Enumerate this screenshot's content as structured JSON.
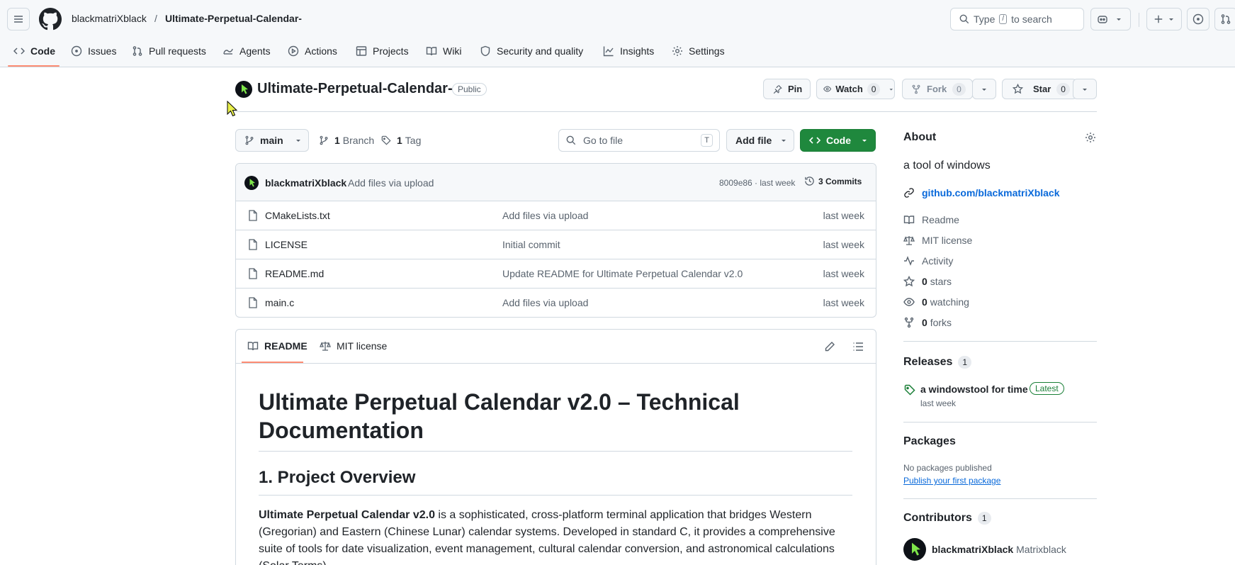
{
  "header": {
    "owner": "blackmatriXblack",
    "separator": "/",
    "repo": "Ultimate-Perpetual-Calendar-",
    "search_placeholder": "Type",
    "search_key": "/",
    "search_suffix": "to search"
  },
  "nav": {
    "tabs": [
      {
        "label": "Code",
        "icon": "code-icon"
      },
      {
        "label": "Issues",
        "icon": "issue-icon"
      },
      {
        "label": "Pull requests",
        "icon": "pull-request-icon"
      },
      {
        "label": "Agents",
        "icon": "agent-icon"
      },
      {
        "label": "Actions",
        "icon": "play-icon"
      },
      {
        "label": "Projects",
        "icon": "table-icon"
      },
      {
        "label": "Wiki",
        "icon": "book-icon"
      },
      {
        "label": "Security and quality",
        "icon": "shield-icon"
      },
      {
        "label": "Insights",
        "icon": "graph-icon"
      },
      {
        "label": "Settings",
        "icon": "gear-icon"
      }
    ]
  },
  "repo": {
    "title": "Ultimate-Perpetual-Calendar-",
    "visibility": "Public",
    "pin_label": "Pin",
    "watch_label": "Watch",
    "watch_count": "0",
    "fork_label": "Fork",
    "fork_count": "0",
    "star_label": "Star",
    "star_count": "0"
  },
  "toolbar": {
    "branch": "main",
    "branch_count": "1",
    "branch_label": "Branch",
    "tag_count": "1",
    "tag_label": "Tag",
    "goto_placeholder": "Go to file",
    "goto_key": "T",
    "add_file_label": "Add file",
    "code_label": "Code"
  },
  "commit": {
    "author": "blackmatriXblack",
    "message": "Add files via upload",
    "hash_time": "8009e86 · last week",
    "commits_label": "3 Commits"
  },
  "files": [
    {
      "name": "CMakeLists.txt",
      "message": "Add files via upload",
      "date": "last week"
    },
    {
      "name": "LICENSE",
      "message": "Initial commit",
      "date": "last week"
    },
    {
      "name": "README.md",
      "message": "Update README for Ultimate Perpetual Calendar v2.0",
      "date": "last week"
    },
    {
      "name": "main.c",
      "message": "Add files via upload",
      "date": "last week"
    }
  ],
  "readme": {
    "tab_readme": "README",
    "tab_license": "MIT license",
    "h1": "Ultimate Perpetual Calendar v2.0 – Technical Documentation",
    "h2": "1. Project Overview",
    "p_bold": "Ultimate Perpetual Calendar v2.0",
    "p_rest": " is a sophisticated, cross-platform terminal application that bridges Western (Gregorian) and Eastern (Chinese Lunar) calendar systems. Developed in standard C, it provides a comprehensive suite of tools for date visualization, event management, cultural calendar conversion, and astronomical calculations (Solar Terms)."
  },
  "about": {
    "heading": "About",
    "description": "a tool of windows",
    "website": "github.com/blackmatriXblack",
    "readme": "Readme",
    "license": "MIT license",
    "activity": "Activity",
    "stars_count": "0",
    "stars_label": "stars",
    "watching_count": "0",
    "watching_label": "watching",
    "forks_count": "0",
    "forks_label": "forks"
  },
  "releases": {
    "heading": "Releases",
    "count": "1",
    "name": "a windowstool for time",
    "badge": "Latest",
    "date": "last week"
  },
  "packages": {
    "heading": "Packages",
    "none": "No packages published",
    "link": "Publish your first package"
  },
  "contributors": {
    "heading": "Contributors",
    "count": "1",
    "login": "blackmatriXblack",
    "name": "Matrixblack"
  },
  "colors": {
    "accent_tab": "#fd8c73",
    "green": "#1f883d",
    "link": "#0969da"
  }
}
